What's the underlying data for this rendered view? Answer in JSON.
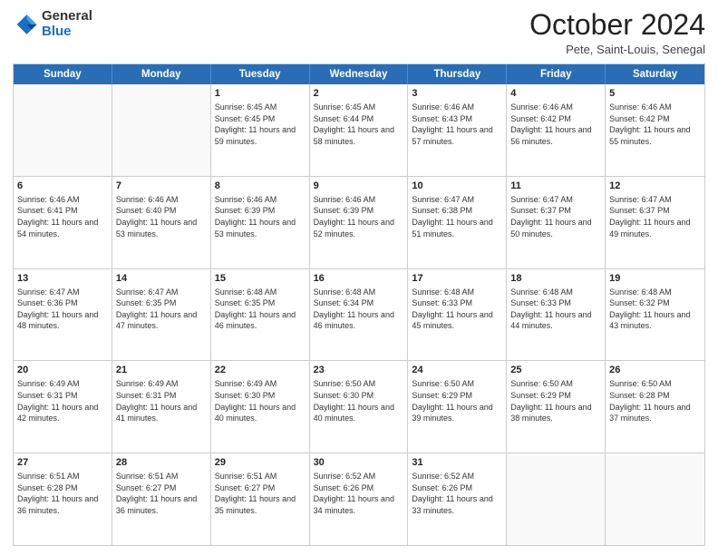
{
  "header": {
    "logo_general": "General",
    "logo_blue": "Blue",
    "title": "October 2024",
    "location": "Pete, Saint-Louis, Senegal"
  },
  "weekdays": [
    "Sunday",
    "Monday",
    "Tuesday",
    "Wednesday",
    "Thursday",
    "Friday",
    "Saturday"
  ],
  "rows": [
    [
      {
        "day": "",
        "text": ""
      },
      {
        "day": "",
        "text": ""
      },
      {
        "day": "1",
        "text": "Sunrise: 6:45 AM\nSunset: 6:45 PM\nDaylight: 11 hours and 59 minutes."
      },
      {
        "day": "2",
        "text": "Sunrise: 6:45 AM\nSunset: 6:44 PM\nDaylight: 11 hours and 58 minutes."
      },
      {
        "day": "3",
        "text": "Sunrise: 6:46 AM\nSunset: 6:43 PM\nDaylight: 11 hours and 57 minutes."
      },
      {
        "day": "4",
        "text": "Sunrise: 6:46 AM\nSunset: 6:42 PM\nDaylight: 11 hours and 56 minutes."
      },
      {
        "day": "5",
        "text": "Sunrise: 6:46 AM\nSunset: 6:42 PM\nDaylight: 11 hours and 55 minutes."
      }
    ],
    [
      {
        "day": "6",
        "text": "Sunrise: 6:46 AM\nSunset: 6:41 PM\nDaylight: 11 hours and 54 minutes."
      },
      {
        "day": "7",
        "text": "Sunrise: 6:46 AM\nSunset: 6:40 PM\nDaylight: 11 hours and 53 minutes."
      },
      {
        "day": "8",
        "text": "Sunrise: 6:46 AM\nSunset: 6:39 PM\nDaylight: 11 hours and 53 minutes."
      },
      {
        "day": "9",
        "text": "Sunrise: 6:46 AM\nSunset: 6:39 PM\nDaylight: 11 hours and 52 minutes."
      },
      {
        "day": "10",
        "text": "Sunrise: 6:47 AM\nSunset: 6:38 PM\nDaylight: 11 hours and 51 minutes."
      },
      {
        "day": "11",
        "text": "Sunrise: 6:47 AM\nSunset: 6:37 PM\nDaylight: 11 hours and 50 minutes."
      },
      {
        "day": "12",
        "text": "Sunrise: 6:47 AM\nSunset: 6:37 PM\nDaylight: 11 hours and 49 minutes."
      }
    ],
    [
      {
        "day": "13",
        "text": "Sunrise: 6:47 AM\nSunset: 6:36 PM\nDaylight: 11 hours and 48 minutes."
      },
      {
        "day": "14",
        "text": "Sunrise: 6:47 AM\nSunset: 6:35 PM\nDaylight: 11 hours and 47 minutes."
      },
      {
        "day": "15",
        "text": "Sunrise: 6:48 AM\nSunset: 6:35 PM\nDaylight: 11 hours and 46 minutes."
      },
      {
        "day": "16",
        "text": "Sunrise: 6:48 AM\nSunset: 6:34 PM\nDaylight: 11 hours and 46 minutes."
      },
      {
        "day": "17",
        "text": "Sunrise: 6:48 AM\nSunset: 6:33 PM\nDaylight: 11 hours and 45 minutes."
      },
      {
        "day": "18",
        "text": "Sunrise: 6:48 AM\nSunset: 6:33 PM\nDaylight: 11 hours and 44 minutes."
      },
      {
        "day": "19",
        "text": "Sunrise: 6:48 AM\nSunset: 6:32 PM\nDaylight: 11 hours and 43 minutes."
      }
    ],
    [
      {
        "day": "20",
        "text": "Sunrise: 6:49 AM\nSunset: 6:31 PM\nDaylight: 11 hours and 42 minutes."
      },
      {
        "day": "21",
        "text": "Sunrise: 6:49 AM\nSunset: 6:31 PM\nDaylight: 11 hours and 41 minutes."
      },
      {
        "day": "22",
        "text": "Sunrise: 6:49 AM\nSunset: 6:30 PM\nDaylight: 11 hours and 40 minutes."
      },
      {
        "day": "23",
        "text": "Sunrise: 6:50 AM\nSunset: 6:30 PM\nDaylight: 11 hours and 40 minutes."
      },
      {
        "day": "24",
        "text": "Sunrise: 6:50 AM\nSunset: 6:29 PM\nDaylight: 11 hours and 39 minutes."
      },
      {
        "day": "25",
        "text": "Sunrise: 6:50 AM\nSunset: 6:29 PM\nDaylight: 11 hours and 38 minutes."
      },
      {
        "day": "26",
        "text": "Sunrise: 6:50 AM\nSunset: 6:28 PM\nDaylight: 11 hours and 37 minutes."
      }
    ],
    [
      {
        "day": "27",
        "text": "Sunrise: 6:51 AM\nSunset: 6:28 PM\nDaylight: 11 hours and 36 minutes."
      },
      {
        "day": "28",
        "text": "Sunrise: 6:51 AM\nSunset: 6:27 PM\nDaylight: 11 hours and 36 minutes."
      },
      {
        "day": "29",
        "text": "Sunrise: 6:51 AM\nSunset: 6:27 PM\nDaylight: 11 hours and 35 minutes."
      },
      {
        "day": "30",
        "text": "Sunrise: 6:52 AM\nSunset: 6:26 PM\nDaylight: 11 hours and 34 minutes."
      },
      {
        "day": "31",
        "text": "Sunrise: 6:52 AM\nSunset: 6:26 PM\nDaylight: 11 hours and 33 minutes."
      },
      {
        "day": "",
        "text": ""
      },
      {
        "day": "",
        "text": ""
      }
    ]
  ]
}
